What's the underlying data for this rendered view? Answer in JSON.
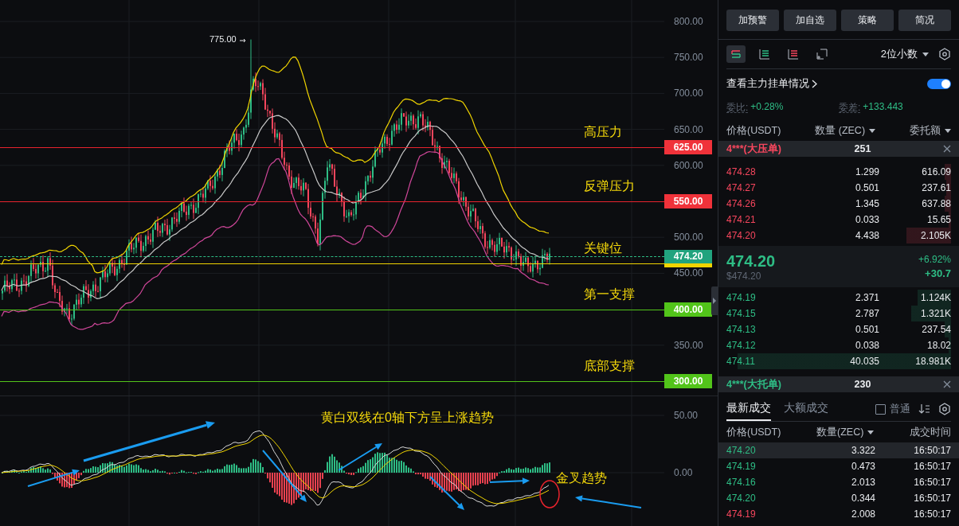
{
  "chart": {
    "y_ticks": [
      "800.00",
      "750.00",
      "700.00",
      "650.00",
      "600.00",
      "500.00",
      "450.00",
      "350.00"
    ],
    "high_marker": "775.00",
    "levels": [
      {
        "label": "高压力",
        "price": "625.00",
        "kind": "resistance"
      },
      {
        "label": "反弹压力",
        "price": "550.00",
        "kind": "resistance"
      },
      {
        "label": "关键位",
        "kind": "key"
      },
      {
        "label": "第一支撑",
        "price": "400.00",
        "kind": "support"
      },
      {
        "label": "底部支撑",
        "price": "300.00",
        "kind": "support"
      }
    ],
    "current_price": "474.20"
  },
  "indicator": {
    "y_ticks": [
      "50.00",
      "0.00"
    ],
    "notes": [
      "黄白双线在0轴下方呈上涨趋势",
      "金叉趋势"
    ]
  },
  "actions": [
    "加预警",
    "加自选",
    "策略",
    "简况"
  ],
  "book_views": [
    {
      "kind": "both",
      "selected": true
    },
    {
      "kind": "bids",
      "selected": false
    },
    {
      "kind": "asks",
      "selected": false
    },
    {
      "kind": "custom",
      "selected": false
    }
  ],
  "precision": "2位小数",
  "main_orders": {
    "label": "查看主力挂单情况",
    "on": true
  },
  "ratio": {
    "label": "委比:",
    "value": "+0.28%"
  },
  "diff": {
    "label": "委差:",
    "value": "+133.443"
  },
  "book_columns": [
    {
      "label": "价格(USDT)",
      "dropdown": false
    },
    {
      "label": "数量 (ZEC)",
      "dropdown": true
    },
    {
      "label": "委托额",
      "dropdown": true
    }
  ],
  "big_ask": {
    "label": "4***(大压单)",
    "count": "251"
  },
  "asks": [
    {
      "price": "474.28",
      "amount": "1.299",
      "total": "616.09"
    },
    {
      "price": "474.27",
      "amount": "0.501",
      "total": "237.61"
    },
    {
      "price": "474.26",
      "amount": "1.345",
      "total": "637.88"
    },
    {
      "price": "474.21",
      "amount": "0.033",
      "total": "15.65"
    },
    {
      "price": "474.20",
      "amount": "4.438",
      "total": "2.105K"
    }
  ],
  "last": {
    "price": "474.20",
    "usd": "$474.20",
    "change_pct": "+6.92%",
    "change": "+30.7"
  },
  "bids": [
    {
      "price": "474.19",
      "amount": "2.371",
      "total": "1.124K"
    },
    {
      "price": "474.15",
      "amount": "2.787",
      "total": "1.321K"
    },
    {
      "price": "474.13",
      "amount": "0.501",
      "total": "237.54"
    },
    {
      "price": "474.12",
      "amount": "0.038",
      "total": "18.02"
    },
    {
      "price": "474.11",
      "amount": "40.035",
      "total": "18.981K"
    }
  ],
  "big_bid": {
    "label": "4***(大托单)",
    "count": "230"
  },
  "trade_tabs": [
    {
      "label": "最新成交",
      "selected": true
    },
    {
      "label": "大额成交",
      "selected": false
    }
  ],
  "normal_filter": {
    "label": "普通",
    "checked": false
  },
  "trade_columns": [
    {
      "label": "价格(USDT)",
      "dropdown": false
    },
    {
      "label": "数量(ZEC)",
      "dropdown": true
    },
    {
      "label": "成交时间",
      "dropdown": false
    }
  ],
  "trades": [
    {
      "price": "474.20",
      "amount": "3.322",
      "time": "16:50:17",
      "kind": "buy",
      "selected": true
    },
    {
      "price": "474.19",
      "amount": "0.473",
      "time": "16:50:17",
      "kind": "buy",
      "selected": false
    },
    {
      "price": "474.16",
      "amount": "2.013",
      "time": "16:50:17",
      "kind": "buy",
      "selected": false
    },
    {
      "price": "474.20",
      "amount": "0.344",
      "time": "16:50:17",
      "kind": "buy",
      "selected": false
    },
    {
      "price": "474.19",
      "amount": "2.008",
      "time": "16:50:17",
      "kind": "sell",
      "selected": false
    }
  ]
}
